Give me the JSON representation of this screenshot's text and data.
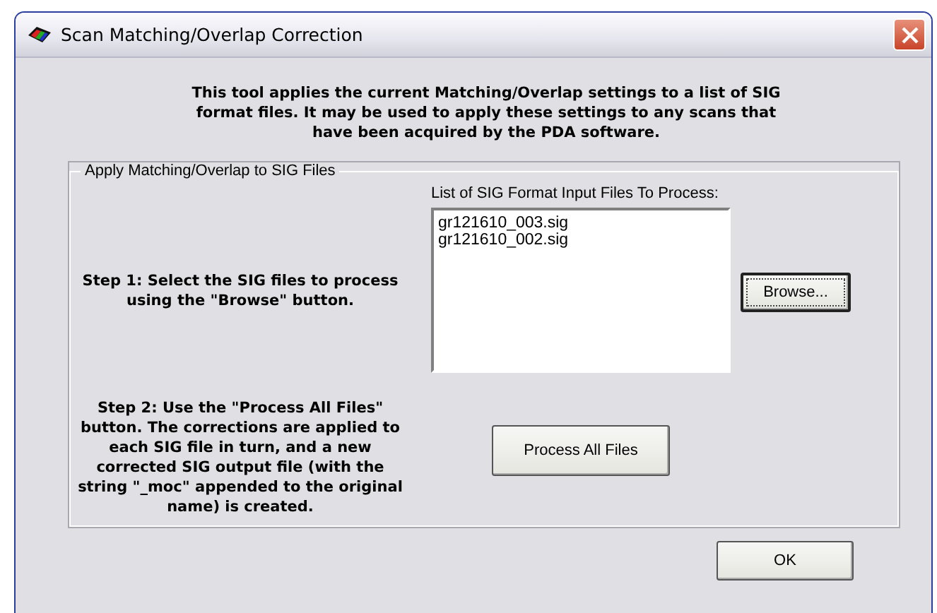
{
  "window": {
    "title": "Scan Matching/Overlap Correction"
  },
  "description": "This tool applies the current Matching/Overlap settings to a list of SIG format files. It may be used to apply these settings to any scans that have been acquired by the PDA software.",
  "group": {
    "title": "Apply Matching/Overlap to SIG Files",
    "step1": "Step 1: Select the SIG files to process using the \"Browse\" button.",
    "list_label": "List of SIG Format Input Files To Process:",
    "files": [
      "gr121610_003.sig",
      "gr121610_002.sig"
    ],
    "browse_button": "Browse...",
    "step2": "Step 2: Use the \"Process All Files\" button. The corrections are applied to each SIG file in turn, and a new corrected SIG output file (with the string \"_moc\" appended to the original name) is created.",
    "process_button": "Process All Files"
  },
  "ok_button": "OK"
}
